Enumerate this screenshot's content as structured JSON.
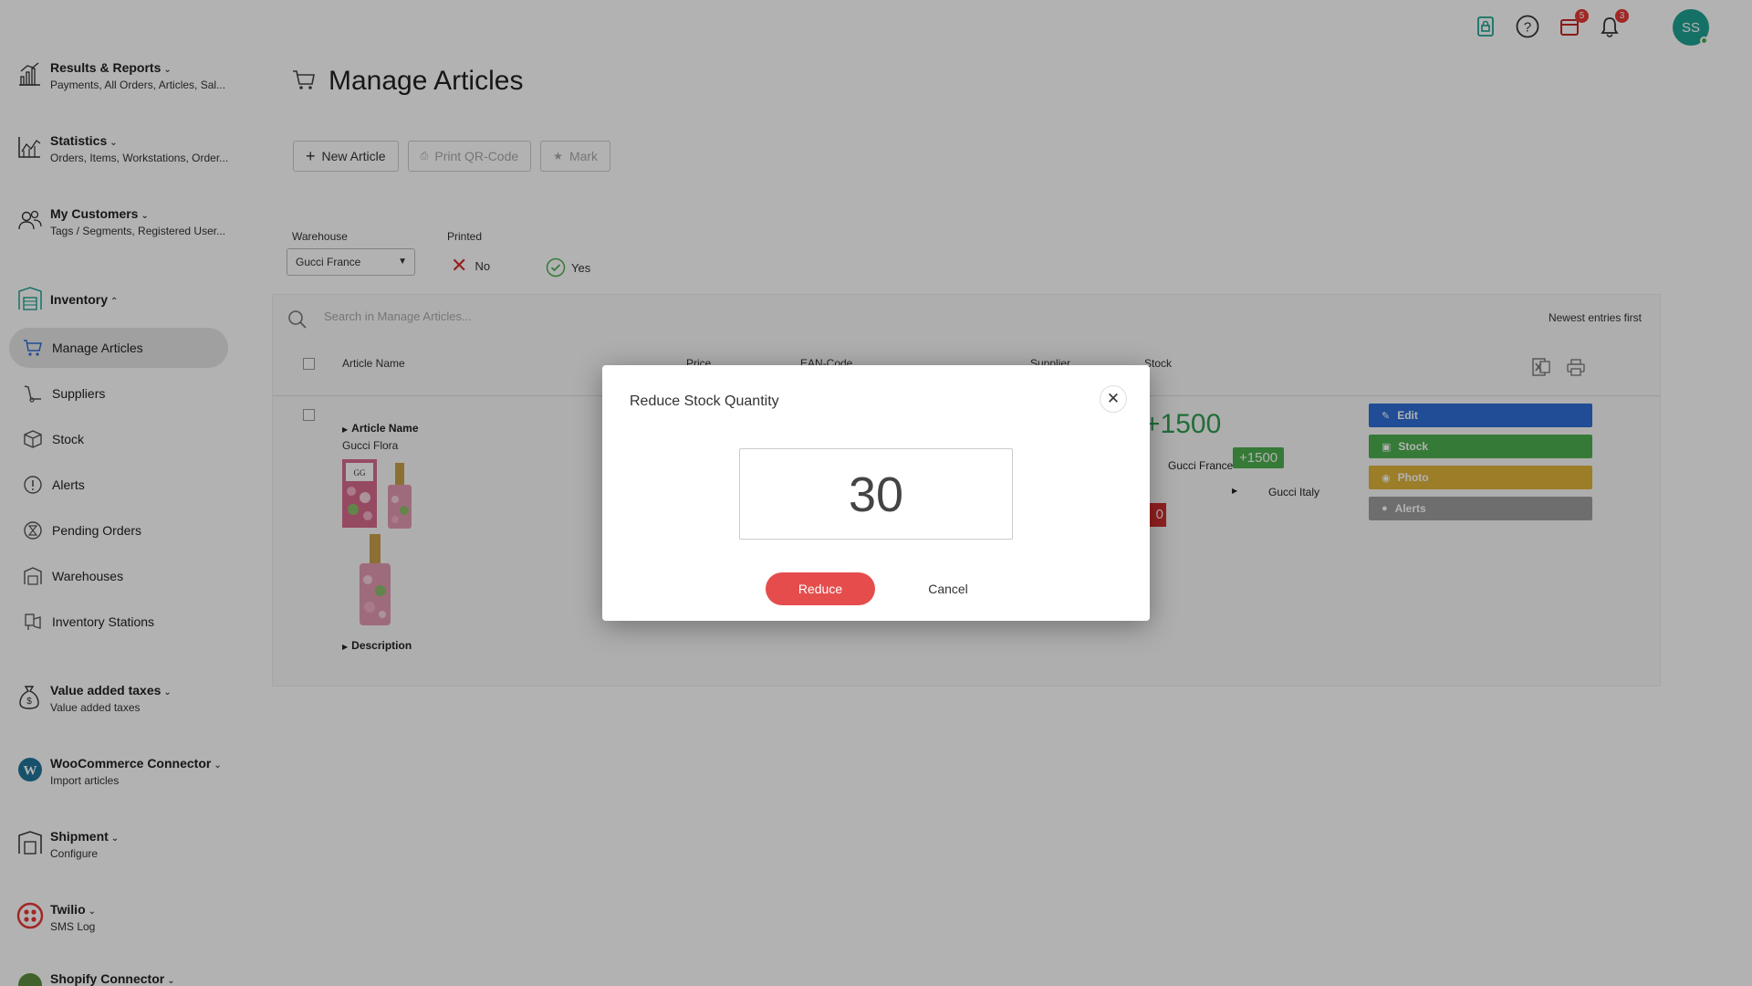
{
  "topbar": {
    "icons": [
      {
        "name": "device-lock-icon",
        "badge": ""
      },
      {
        "name": "help-icon",
        "badge": ""
      },
      {
        "name": "calendar-icon",
        "badge": "5"
      },
      {
        "name": "bell-icon",
        "badge": "3"
      }
    ],
    "avatar_initials": "SS"
  },
  "sidebar": {
    "groups": [
      {
        "title": "Results & Reports",
        "subtitle": "Payments, All Orders, Articles, Sal..."
      },
      {
        "title": "Statistics",
        "subtitle": "Orders, Items, Workstations, Order..."
      },
      {
        "title": "My Customers",
        "subtitle": "Tags / Segments, Registered User..."
      },
      {
        "title": "Inventory",
        "subtitle": ""
      },
      {
        "title": "Value added taxes",
        "subtitle": "Value added taxes"
      },
      {
        "title": "WooCommerce Connector",
        "subtitle": "Import articles"
      },
      {
        "title": "Shipment",
        "subtitle": "Configure"
      },
      {
        "title": "Twilio",
        "subtitle": "SMS Log"
      },
      {
        "title": "Shopify Connector",
        "subtitle": ""
      }
    ],
    "inventory_items": [
      {
        "label": "Manage Articles"
      },
      {
        "label": "Suppliers"
      },
      {
        "label": "Stock"
      },
      {
        "label": "Alerts"
      },
      {
        "label": "Pending Orders"
      },
      {
        "label": "Warehouses"
      },
      {
        "label": "Inventory Stations"
      }
    ]
  },
  "main": {
    "title": "Manage Articles",
    "toolbar": {
      "new_article": "New Article",
      "print_qr": "Print QR-Code",
      "mark": "Mark"
    },
    "filters": {
      "warehouse_label": "Warehouse",
      "warehouse_value": "Gucci France",
      "printed_label": "Printed",
      "printed_no": "No",
      "printed_yes": "Yes"
    },
    "search_placeholder": "Search in Manage Articles...",
    "sort_label": "Newest entries first",
    "columns": [
      "Article Name",
      "Price",
      "EAN-Code",
      "Supplier",
      "Stock"
    ],
    "row": {
      "article_name_label": "Article Name",
      "article_name": "Gucci Flora",
      "description_label": "Description",
      "stock_total": "+1500",
      "stock_loc_1": "Gucci France",
      "stock_loc_1_badge": "+1500",
      "stock_loc_2": "Gucci Italy",
      "red_badge": "0",
      "actions": {
        "edit": "Edit",
        "stock": "Stock",
        "photo": "Photo",
        "alerts": "Alerts"
      }
    }
  },
  "modal": {
    "title": "Reduce Stock Quantity",
    "quantity": "30",
    "reduce_label": "Reduce",
    "cancel_label": "Cancel"
  },
  "colors": {
    "accent": "#1fa393",
    "edit": "#2f6fd6",
    "stock": "#4caf50",
    "photo": "#e0b33a",
    "alerts": "#9e9e9e",
    "reduce": "#e54d4d"
  }
}
